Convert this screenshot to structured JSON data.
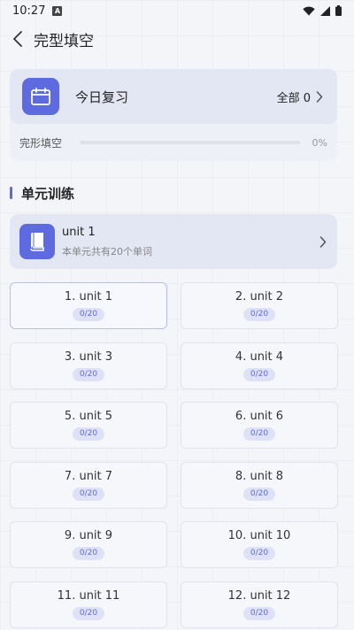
{
  "status": {
    "time": "10:27",
    "a_badge": "A"
  },
  "header": {
    "title": "完型填空"
  },
  "review": {
    "title": "今日复习",
    "all_label": "全部 0",
    "progress_label": "完形填空",
    "progress_pct": "0%",
    "progress_fraction": 0
  },
  "section": {
    "title": "单元训练"
  },
  "current_unit": {
    "name": "unit 1",
    "desc": "本单元共有20个单词"
  },
  "units": [
    {
      "label": "1. unit 1",
      "progress": "0/20"
    },
    {
      "label": "2. unit 2",
      "progress": "0/20"
    },
    {
      "label": "3. unit 3",
      "progress": "0/20"
    },
    {
      "label": "4. unit 4",
      "progress": "0/20"
    },
    {
      "label": "5. unit 5",
      "progress": "0/20"
    },
    {
      "label": "6. unit 6",
      "progress": "0/20"
    },
    {
      "label": "7. unit 7",
      "progress": "0/20"
    },
    {
      "label": "8. unit 8",
      "progress": "0/20"
    },
    {
      "label": "9. unit 9",
      "progress": "0/20"
    },
    {
      "label": "10. unit 10",
      "progress": "0/20"
    },
    {
      "label": "11. unit 11",
      "progress": "0/20"
    },
    {
      "label": "12. unit 12",
      "progress": "0/20"
    }
  ],
  "colors": {
    "accent": "#5d6ae0",
    "card_bg": "#e3e6f3"
  },
  "icons": [
    "back-arrow-icon",
    "calendar-icon",
    "chevron-right-icon",
    "book-icon",
    "wifi-icon",
    "signal-icon",
    "battery-icon"
  ]
}
